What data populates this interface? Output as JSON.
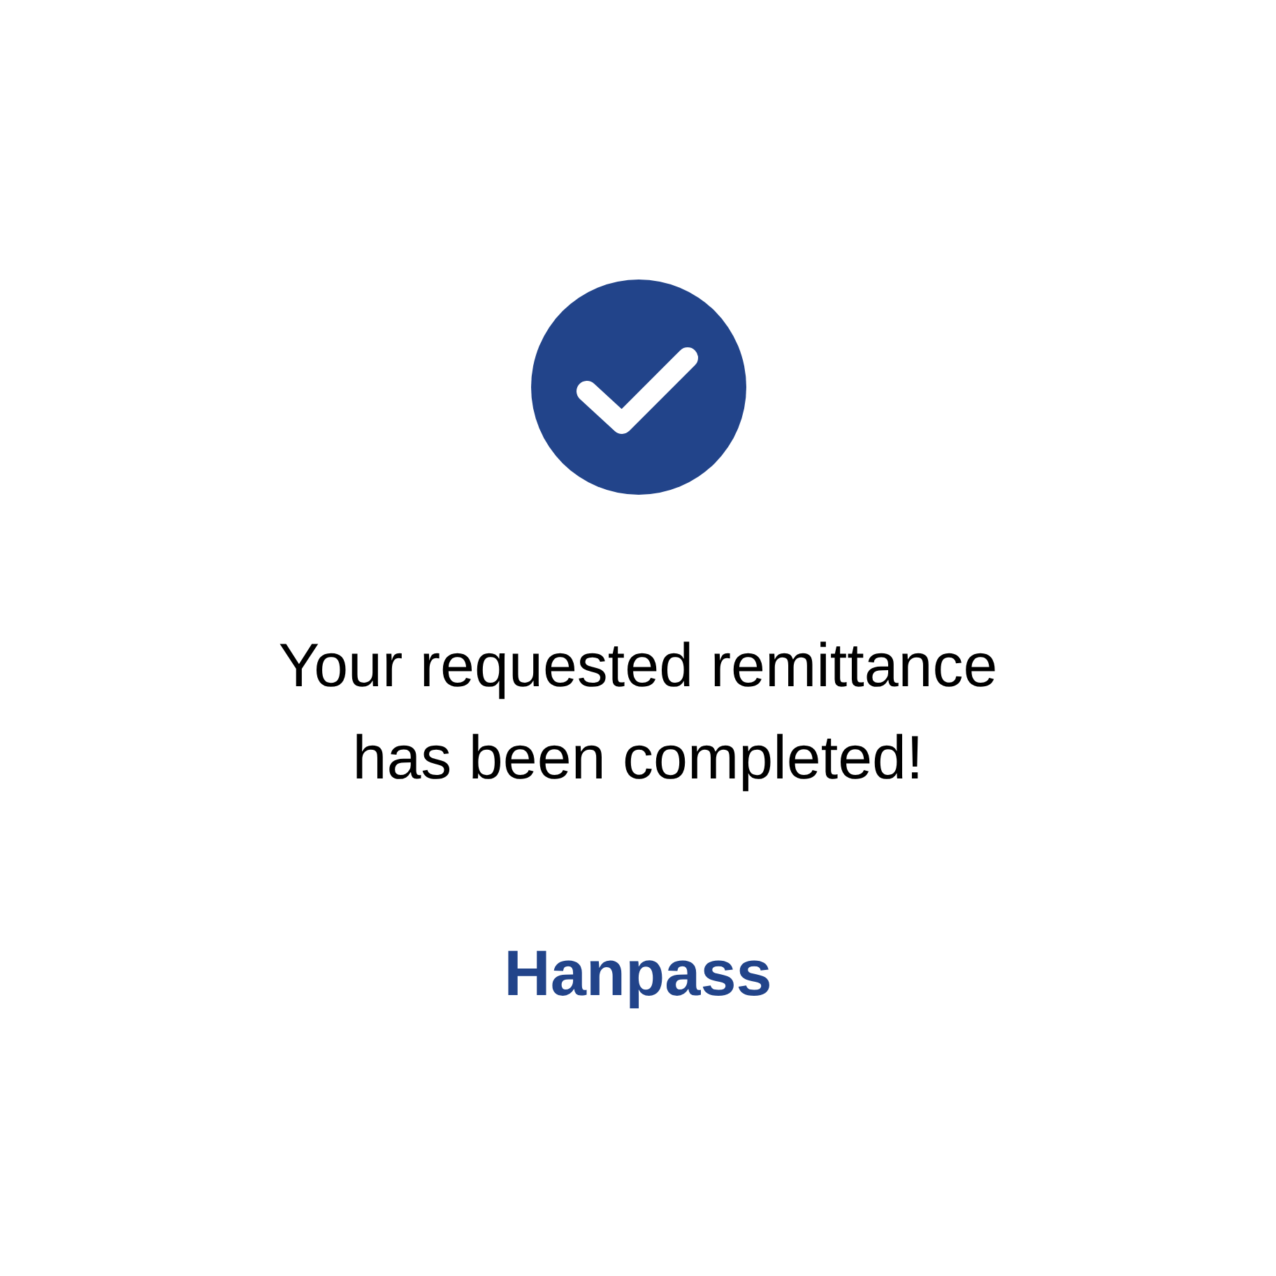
{
  "message": {
    "lines": [
      "Your requested remittance",
      "has been completed!"
    ]
  },
  "brand": {
    "name": "Hanpass"
  }
}
